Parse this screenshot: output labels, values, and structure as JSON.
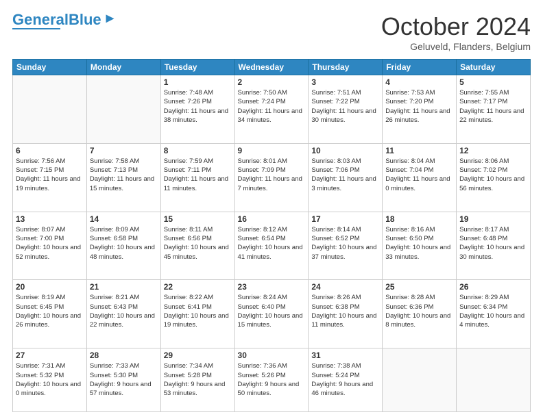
{
  "logo": {
    "line1": "General",
    "line2": "Blue"
  },
  "title": "October 2024",
  "subtitle": "Geluveld, Flanders, Belgium",
  "days_header": [
    "Sunday",
    "Monday",
    "Tuesday",
    "Wednesday",
    "Thursday",
    "Friday",
    "Saturday"
  ],
  "weeks": [
    [
      {
        "day": "",
        "info": ""
      },
      {
        "day": "",
        "info": ""
      },
      {
        "day": "1",
        "info": "Sunrise: 7:48 AM\nSunset: 7:26 PM\nDaylight: 11 hours and 38 minutes."
      },
      {
        "day": "2",
        "info": "Sunrise: 7:50 AM\nSunset: 7:24 PM\nDaylight: 11 hours and 34 minutes."
      },
      {
        "day": "3",
        "info": "Sunrise: 7:51 AM\nSunset: 7:22 PM\nDaylight: 11 hours and 30 minutes."
      },
      {
        "day": "4",
        "info": "Sunrise: 7:53 AM\nSunset: 7:20 PM\nDaylight: 11 hours and 26 minutes."
      },
      {
        "day": "5",
        "info": "Sunrise: 7:55 AM\nSunset: 7:17 PM\nDaylight: 11 hours and 22 minutes."
      }
    ],
    [
      {
        "day": "6",
        "info": "Sunrise: 7:56 AM\nSunset: 7:15 PM\nDaylight: 11 hours and 19 minutes."
      },
      {
        "day": "7",
        "info": "Sunrise: 7:58 AM\nSunset: 7:13 PM\nDaylight: 11 hours and 15 minutes."
      },
      {
        "day": "8",
        "info": "Sunrise: 7:59 AM\nSunset: 7:11 PM\nDaylight: 11 hours and 11 minutes."
      },
      {
        "day": "9",
        "info": "Sunrise: 8:01 AM\nSunset: 7:09 PM\nDaylight: 11 hours and 7 minutes."
      },
      {
        "day": "10",
        "info": "Sunrise: 8:03 AM\nSunset: 7:06 PM\nDaylight: 11 hours and 3 minutes."
      },
      {
        "day": "11",
        "info": "Sunrise: 8:04 AM\nSunset: 7:04 PM\nDaylight: 11 hours and 0 minutes."
      },
      {
        "day": "12",
        "info": "Sunrise: 8:06 AM\nSunset: 7:02 PM\nDaylight: 10 hours and 56 minutes."
      }
    ],
    [
      {
        "day": "13",
        "info": "Sunrise: 8:07 AM\nSunset: 7:00 PM\nDaylight: 10 hours and 52 minutes."
      },
      {
        "day": "14",
        "info": "Sunrise: 8:09 AM\nSunset: 6:58 PM\nDaylight: 10 hours and 48 minutes."
      },
      {
        "day": "15",
        "info": "Sunrise: 8:11 AM\nSunset: 6:56 PM\nDaylight: 10 hours and 45 minutes."
      },
      {
        "day": "16",
        "info": "Sunrise: 8:12 AM\nSunset: 6:54 PM\nDaylight: 10 hours and 41 minutes."
      },
      {
        "day": "17",
        "info": "Sunrise: 8:14 AM\nSunset: 6:52 PM\nDaylight: 10 hours and 37 minutes."
      },
      {
        "day": "18",
        "info": "Sunrise: 8:16 AM\nSunset: 6:50 PM\nDaylight: 10 hours and 33 minutes."
      },
      {
        "day": "19",
        "info": "Sunrise: 8:17 AM\nSunset: 6:48 PM\nDaylight: 10 hours and 30 minutes."
      }
    ],
    [
      {
        "day": "20",
        "info": "Sunrise: 8:19 AM\nSunset: 6:45 PM\nDaylight: 10 hours and 26 minutes."
      },
      {
        "day": "21",
        "info": "Sunrise: 8:21 AM\nSunset: 6:43 PM\nDaylight: 10 hours and 22 minutes."
      },
      {
        "day": "22",
        "info": "Sunrise: 8:22 AM\nSunset: 6:41 PM\nDaylight: 10 hours and 19 minutes."
      },
      {
        "day": "23",
        "info": "Sunrise: 8:24 AM\nSunset: 6:40 PM\nDaylight: 10 hours and 15 minutes."
      },
      {
        "day": "24",
        "info": "Sunrise: 8:26 AM\nSunset: 6:38 PM\nDaylight: 10 hours and 11 minutes."
      },
      {
        "day": "25",
        "info": "Sunrise: 8:28 AM\nSunset: 6:36 PM\nDaylight: 10 hours and 8 minutes."
      },
      {
        "day": "26",
        "info": "Sunrise: 8:29 AM\nSunset: 6:34 PM\nDaylight: 10 hours and 4 minutes."
      }
    ],
    [
      {
        "day": "27",
        "info": "Sunrise: 7:31 AM\nSunset: 5:32 PM\nDaylight: 10 hours and 0 minutes."
      },
      {
        "day": "28",
        "info": "Sunrise: 7:33 AM\nSunset: 5:30 PM\nDaylight: 9 hours and 57 minutes."
      },
      {
        "day": "29",
        "info": "Sunrise: 7:34 AM\nSunset: 5:28 PM\nDaylight: 9 hours and 53 minutes."
      },
      {
        "day": "30",
        "info": "Sunrise: 7:36 AM\nSunset: 5:26 PM\nDaylight: 9 hours and 50 minutes."
      },
      {
        "day": "31",
        "info": "Sunrise: 7:38 AM\nSunset: 5:24 PM\nDaylight: 9 hours and 46 minutes."
      },
      {
        "day": "",
        "info": ""
      },
      {
        "day": "",
        "info": ""
      }
    ]
  ]
}
